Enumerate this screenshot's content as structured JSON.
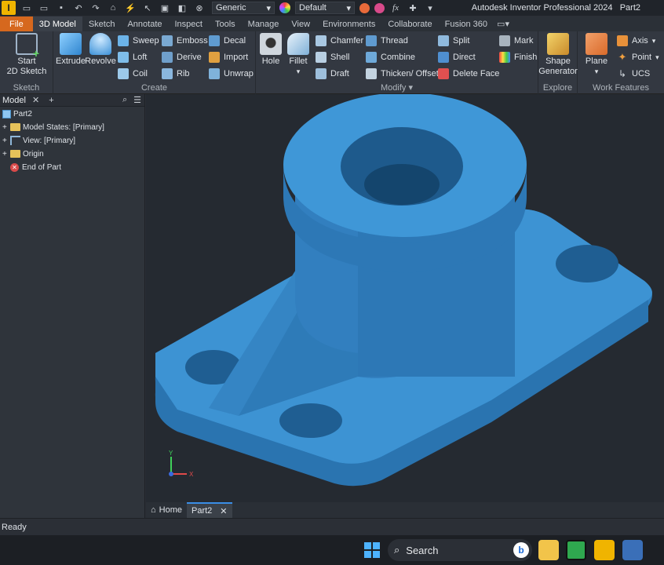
{
  "app": {
    "logo_letter": "I",
    "title": "Autodesk Inventor Professional 2024",
    "document": "Part2"
  },
  "quick_access": {
    "appearance_value": "Generic",
    "material_value": "Default",
    "fx": "fx"
  },
  "tabs": [
    "File",
    "3D Model",
    "Sketch",
    "Annotate",
    "Inspect",
    "Tools",
    "Manage",
    "View",
    "Environments",
    "Collaborate",
    "Fusion 360"
  ],
  "active_tab": "3D Model",
  "ribbon": {
    "sketch": {
      "title": "Sketch",
      "start_line1": "Start",
      "start_line2": "2D Sketch"
    },
    "create": {
      "title": "Create",
      "extrude": "Extrude",
      "revolve": "Revolve",
      "col1": [
        "Sweep",
        "Loft",
        "Coil"
      ],
      "col2": [
        "Emboss",
        "Derive",
        "Rib"
      ],
      "col3": [
        "Decal",
        "Import",
        "Unwrap"
      ]
    },
    "modify": {
      "title": "Modify",
      "hole": "Hole",
      "fillet": "Fillet",
      "col1": [
        "Chamfer",
        "Shell",
        "Draft"
      ],
      "col2": [
        "Thread",
        "Combine",
        "Thicken/ Offset"
      ],
      "col3": [
        "Split",
        "Direct",
        "Delete Face"
      ],
      "col4": [
        "Mark",
        "Finish"
      ]
    },
    "explore": {
      "title": "Explore",
      "shape_line1": "Shape",
      "shape_line2": "Generator"
    },
    "work_features": {
      "title": "Work Features",
      "plane": "Plane",
      "items": [
        "Axis",
        "Point",
        "UCS"
      ]
    }
  },
  "browser": {
    "tab": "Model",
    "tree": [
      "Part2",
      "Model States: [Primary]",
      "View: [Primary]",
      "Origin",
      "End of Part"
    ]
  },
  "viewport": {
    "triad_x": "X",
    "triad_y": "Y",
    "part_color": "#3d93d3"
  },
  "doc_tabs": [
    "Home",
    "Part2"
  ],
  "status": "Ready",
  "taskbar": {
    "search": "Search"
  }
}
